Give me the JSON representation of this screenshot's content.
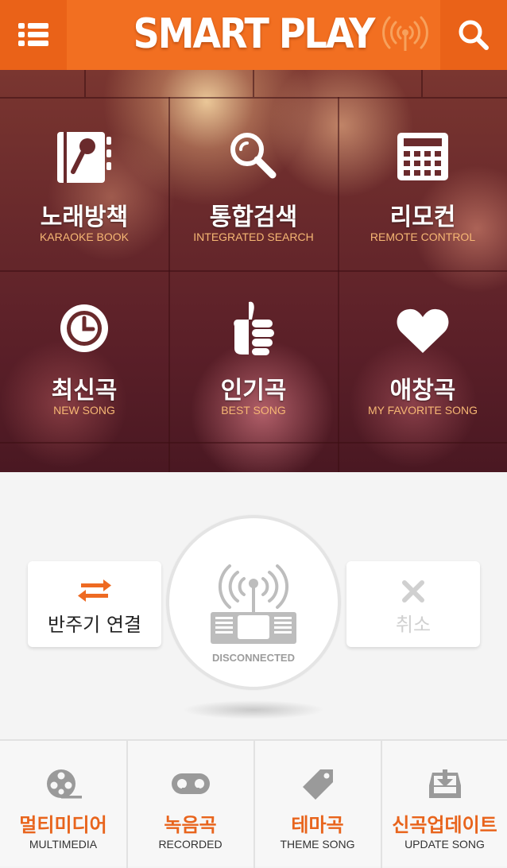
{
  "header": {
    "title": "SMART PLAY",
    "menu_icon": "list-menu-icon",
    "search_icon": "search-icon",
    "signal_icon": "wireless-signal-icon"
  },
  "menu": [
    {
      "ko": "노래방책",
      "en": "KARAOKE BOOK",
      "icon": "microphone-book-icon"
    },
    {
      "ko": "통합검색",
      "en": "INTEGRATED SEARCH",
      "icon": "magnifier-icon"
    },
    {
      "ko": "리모컨",
      "en": "REMOTE CONTROL",
      "icon": "remote-keypad-icon"
    },
    {
      "ko": "최신곡",
      "en": "NEW SONG",
      "icon": "clock-icon"
    },
    {
      "ko": "인기곡",
      "en": "BEST SONG",
      "icon": "thumbs-up-icon"
    },
    {
      "ko": "애창곡",
      "en": "MY FAVORITE SONG",
      "icon": "heart-icon"
    }
  ],
  "connect": {
    "connect_label": "반주기 연결",
    "status": "DISCONNECTED",
    "cancel_label": "취소"
  },
  "bottom_nav": [
    {
      "ko": "멀티미디어",
      "en": "MULTIMEDIA",
      "icon": "film-reel-icon"
    },
    {
      "ko": "녹음곡",
      "en": "RECORDED",
      "icon": "cassette-tape-icon"
    },
    {
      "ko": "테마곡",
      "en": "THEME SONG",
      "icon": "tag-icon"
    },
    {
      "ko": "신곡업데이트",
      "en": "UPDATE SONG",
      "icon": "download-tray-icon"
    }
  ],
  "colors": {
    "accent": "#f26f21",
    "accent_dark": "#ea6218",
    "subtitle": "#f6b774",
    "nav_label": "#e8641c"
  }
}
